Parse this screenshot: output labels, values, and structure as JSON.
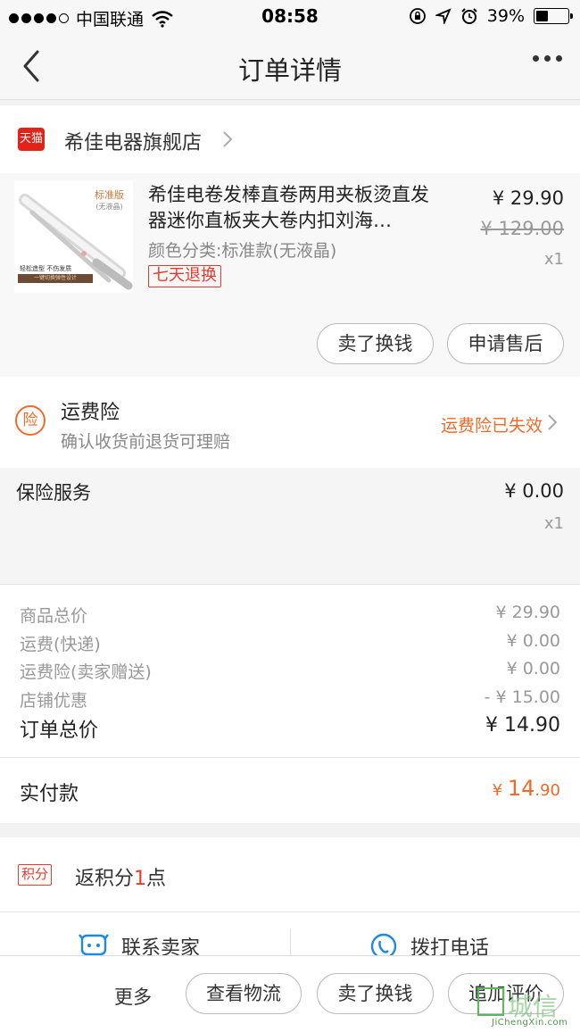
{
  "status_bar": {
    "carrier": "中国联通",
    "time": "08:58",
    "battery": "39%",
    "battery_level": 0.39
  },
  "nav": {
    "title": "订单详情"
  },
  "shop": {
    "icon_text": "天猫",
    "name": "希佳电器旗舰店"
  },
  "product": {
    "title": "希佳电卷发棒直卷两用夹板烫直发器迷你直板夹大卷内扣刘海…",
    "spec": "颜色分类:标准款(无液晶)",
    "badge": "七天退换",
    "price": "¥ 29.90",
    "original_price": "¥ 129.00",
    "quantity": "x1",
    "thumb_edition": "标准版",
    "thumb_edition_sub": "(无液晶)",
    "thumb_tag": "轻松造型 不伤发质",
    "thumb_bar": "一键切换弹性设计",
    "sell_button": "卖了换钱",
    "after_sale_button": "申请售后"
  },
  "freight_insurance": {
    "icon_text": "险",
    "title": "运费险",
    "subtitle": "确认收货前退货可理赔",
    "status": "运费险已失效"
  },
  "insurance_service": {
    "title": "保险服务",
    "price": "¥ 0.00",
    "quantity": "x1"
  },
  "summary": {
    "rows": [
      {
        "label": "商品总价",
        "value": "¥ 29.90"
      },
      {
        "label": "运费(快递)",
        "value": "¥ 0.00"
      },
      {
        "label": "运费险(卖家赠送)",
        "value": "¥ 0.00"
      },
      {
        "label": "店铺优惠",
        "value": "- ¥ 15.00"
      }
    ],
    "total_label": "订单总价",
    "total_value": "¥ 14.90"
  },
  "paid": {
    "label": "实付款",
    "currency": "¥ ",
    "integer": "14",
    "decimal": ".90"
  },
  "points": {
    "badge": "积分",
    "text_prefix": "返积分",
    "count": "1",
    "text_suffix": "点"
  },
  "contact": {
    "seller": "联系卖家",
    "phone": "拨打电话"
  },
  "bottom_bar": {
    "more": "更多",
    "logistics": "查看物流",
    "sell": "卖了换钱",
    "review": "追加评价"
  },
  "watermark": {
    "text": "城信",
    "url": "JiChengXin.com"
  },
  "colors": {
    "accent_orange": "#f06a2a",
    "accent_red": "#e83a2f",
    "tmall_red": "#e2231a",
    "contact_blue": "#1e88e5"
  }
}
